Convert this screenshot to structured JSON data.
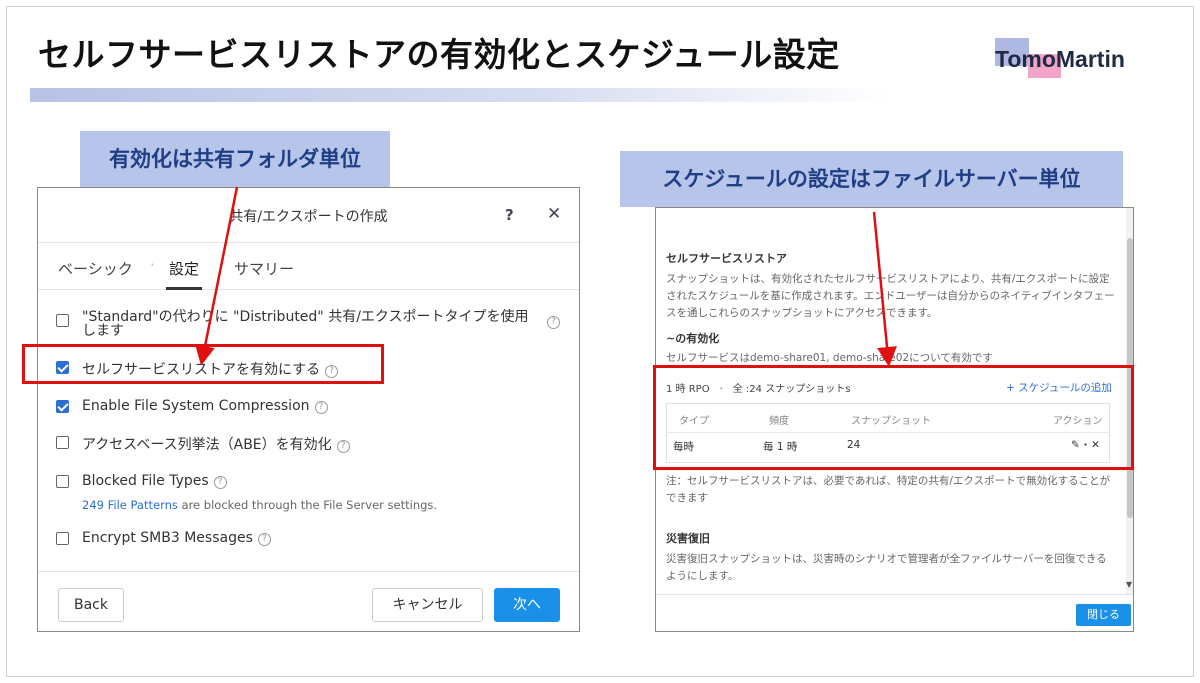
{
  "slide": {
    "title": "セルフサービスリストアの有効化とスケジュール設定",
    "logo_text": "TomoMartin",
    "callout_left": "有効化は共有フォルダ単位",
    "callout_right": "スケジュールの設定はファイルサーバー単位"
  },
  "dialog": {
    "title": "共有/エクスポートの作成",
    "help_icon": "?",
    "close_icon": "✕",
    "tabs": [
      "ベーシック",
      "設定",
      "サマリー"
    ],
    "tab_separator": "·",
    "active_tab": "設定",
    "options": [
      {
        "label": "\"Standard\"の代わりに \"Distributed\" 共有/エクスポートタイプを使用します",
        "checked": false
      },
      {
        "label": "セルフサービスリストアを有効にする",
        "checked": true
      },
      {
        "label": "Enable File System Compression",
        "checked": true
      },
      {
        "label": "アクセスベース列挙法（ABE）を有効化",
        "checked": false
      },
      {
        "label": "Blocked File Types",
        "checked": false
      },
      {
        "label": "Encrypt SMB3 Messages",
        "checked": false
      }
    ],
    "blocked_link": "249 File Patterns",
    "blocked_note": " are blocked through the File Server settings.",
    "buttons": {
      "back": "Back",
      "cancel": "キャンセル",
      "next": "次へ"
    }
  },
  "panel": {
    "section_title": "セルフサービスリストア",
    "description_1": "スナップショットは、有効化されたセルフサービスリストアにより、共有/エクスポートに設定",
    "description_2": "されたスケジュールを基に作成されます。エンドユーザーは自分からのネイティブインタフェー",
    "description_3": "スを通しこれらのスナップショットにアクセスできます。",
    "enable_heading": "~の有効化",
    "enable_text": "セルフサービスはdemo-share01, demo-share02について有効です",
    "schedule_summary": "1 時 RPO　·　全 :24 スナップショットs",
    "add_schedule": "+ スケジュールの追加",
    "table": {
      "headers": [
        "タイプ",
        "頻度",
        "スナップショット",
        "アクション"
      ],
      "row": {
        "type": "毎時",
        "frequency": "毎 1 時",
        "snapshots": "24",
        "actions": "✎ · ✕"
      }
    },
    "note_1": "注：セルフサービスリストアは、必要であれば、特定の共有/エクスポートで無効化することが",
    "note_2": "できます",
    "dr_heading": "災害復旧",
    "dr_text_1": "災害復旧スナップショットは、災害時のシナリオで管理者が全ファイルサーバーを回復できる",
    "dr_text_2": "ようにします。",
    "close_button": "閉じる",
    "scroll_down_icon": "▼"
  },
  "colors": {
    "accent_blue": "#1a90e8",
    "callout_bg": "#b7c5ea",
    "highlight_red": "#e01010"
  }
}
